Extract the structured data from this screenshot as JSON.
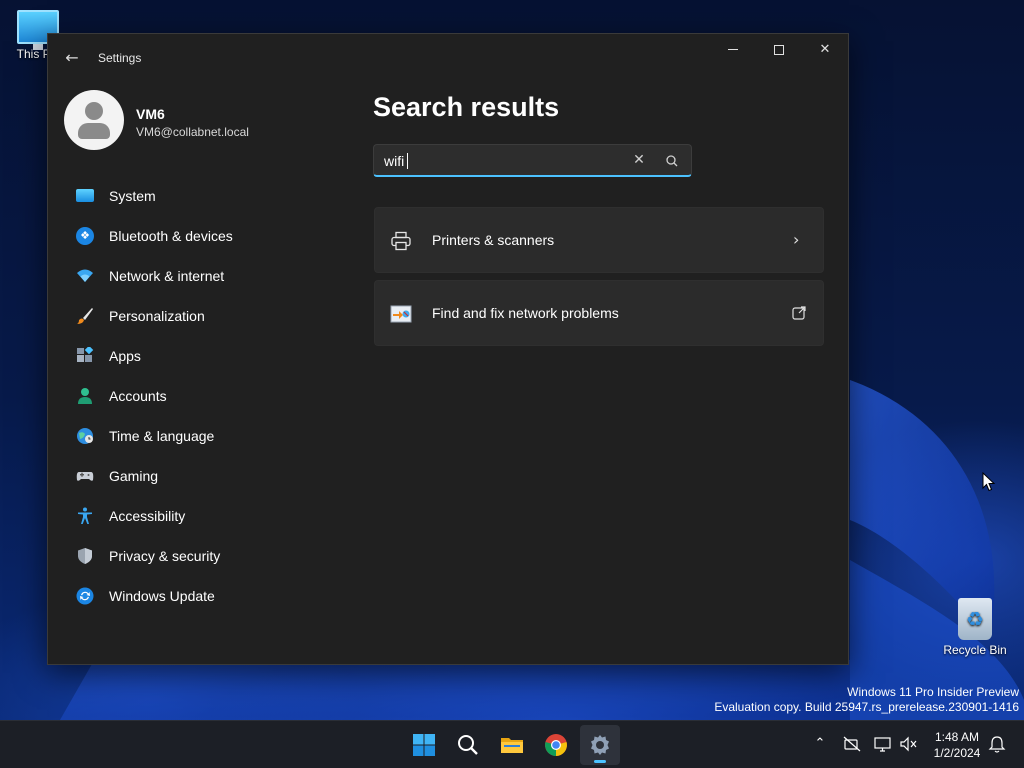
{
  "desktop": {
    "icons": [
      {
        "label": "This PC",
        "icon": "monitor-icon"
      },
      {
        "label": "Recycle Bin",
        "icon": "recycle-bin-icon"
      }
    ],
    "watermark_line1": "Windows 11 Pro Insider Preview",
    "watermark_line2": "Evaluation copy. Build 25947.rs_prerelease.230901-1416"
  },
  "window": {
    "title": "Settings",
    "controls": {
      "minimize": "minimize-icon",
      "maximize": "maximize-icon",
      "close": "close-icon"
    },
    "back": "back-arrow-icon"
  },
  "profile": {
    "name": "VM6",
    "email": "VM6@collabnet.local"
  },
  "nav": {
    "items": [
      {
        "label": "System",
        "icon": "monitor-icon"
      },
      {
        "label": "Bluetooth & devices",
        "icon": "bluetooth-icon"
      },
      {
        "label": "Network & internet",
        "icon": "wifi-icon"
      },
      {
        "label": "Personalization",
        "icon": "brush-icon"
      },
      {
        "label": "Apps",
        "icon": "apps-icon"
      },
      {
        "label": "Accounts",
        "icon": "person-icon"
      },
      {
        "label": "Time & language",
        "icon": "globe-clock-icon"
      },
      {
        "label": "Gaming",
        "icon": "gamepad-icon"
      },
      {
        "label": "Accessibility",
        "icon": "accessibility-icon"
      },
      {
        "label": "Privacy & security",
        "icon": "shield-icon"
      },
      {
        "label": "Windows Update",
        "icon": "update-icon"
      }
    ]
  },
  "main": {
    "title": "Search results",
    "search": {
      "value": "wifi",
      "placeholder": ""
    },
    "results": [
      {
        "label": "Printers & scanners",
        "icon": "printer-icon",
        "action": "chevron-right-icon"
      },
      {
        "label": "Find and fix network problems",
        "icon": "network-troubleshoot-icon",
        "action": "open-external-icon"
      }
    ]
  },
  "taskbar": {
    "apps": [
      "start-icon",
      "search-icon",
      "file-explorer-icon",
      "chrome-icon",
      "settings-icon"
    ],
    "clock": {
      "time": "1:48 AM",
      "date": "1/2/2024"
    }
  },
  "colors": {
    "accent": "#4cc2ff",
    "window_bg": "#202020",
    "card_bg": "#2b2b2b",
    "taskbar_bg": "#1c1f26"
  }
}
